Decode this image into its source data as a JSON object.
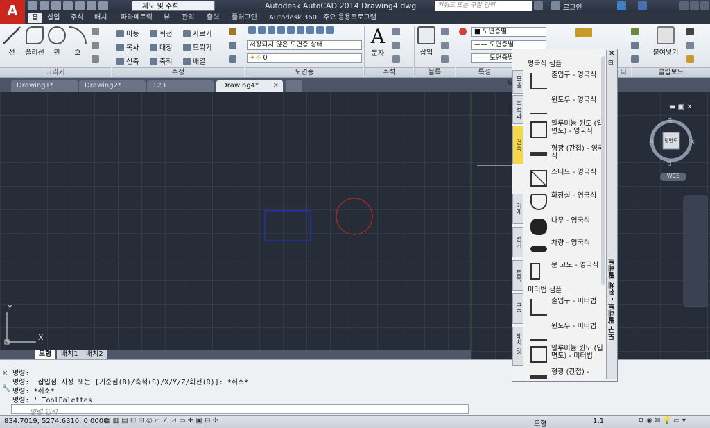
{
  "app": {
    "logo": "A",
    "title": "Autodesk AutoCAD 2014   Drawing4.dwg",
    "workspace": "제도 및 주석",
    "search_placeholder": "키워드 또는 구절 입력",
    "login": "로그인"
  },
  "ribbon_tabs": [
    "홈",
    "삽입",
    "주석",
    "배치",
    "파라메트릭",
    "뷰",
    "관리",
    "출력",
    "플러그인",
    "Autodesk 360",
    "주요 응용프로그램"
  ],
  "draw": {
    "line": "선",
    "polyline": "폴리선",
    "circle": "원",
    "arc": "호",
    "group": "그리기"
  },
  "modify": {
    "move": "이동",
    "rotate": "회전",
    "trim": "자르기",
    "copy": "복사",
    "mirror": "대칭",
    "fillet": "모깎기",
    "stretch": "신축",
    "scale": "축척",
    "array": "배열",
    "group": "수정"
  },
  "layers": {
    "state": "저장되지 않은 도면층 상태",
    "current": "0",
    "group": "도면층"
  },
  "annotation": {
    "text": "문자",
    "group": "주석"
  },
  "block": {
    "insert": "삽입",
    "group": "블록"
  },
  "properties": {
    "color": "도면층별",
    "linetype": "도면층별",
    "lineweight": "도면층별",
    "group": "특성"
  },
  "clipboard": {
    "paste": "붙여넣기",
    "group": "클립보드"
  },
  "utilities": {
    "group": "유틸리티"
  },
  "doc_tabs": [
    "Drawing1*",
    "Drawing2*",
    "123",
    "Drawing4*"
  ],
  "layout_tabs": [
    "모형",
    "배치1",
    "배치2"
  ],
  "viewcube": {
    "top": "북",
    "bottom": "남",
    "left": "서",
    "right": "동",
    "face": "평면도",
    "wcs": "WCS"
  },
  "ucs": {
    "x": "X",
    "y": "Y"
  },
  "command_lines": [
    "명령:",
    "명령:  삽입점 지정 또는 [기준점(B)/축척(S)/X/Y/Z/회전(R)]: *취소*",
    "명령: *취소*",
    "명령: '_ToolPalettes"
  ],
  "command_prompt": "명령 입력",
  "status": {
    "coords": "834.7019,  5274.6310, 0.0000",
    "model": "모형",
    "scale": "1:1"
  },
  "palette": {
    "title": "도구 팔레트 - 전체 팔레트",
    "tabs": [
      "모델링",
      "주석과 설계",
      "건축",
      "기계",
      "전기",
      "토목",
      "구조",
      "해치 및..."
    ],
    "section1": "영국식 샘플",
    "section2": "미터법 샘플",
    "items1": [
      "출입구 - 영국식",
      "윈도우 - 영국식",
      "알루미늄 윈도 (입면도) - 영국식",
      "형광 (간접) - 영국식",
      "스터드 - 영국식",
      "화장실 - 영국식",
      "나무 - 영국식",
      "차량 - 영국식",
      "문 고도 - 영국식"
    ],
    "items2": [
      "출입구 - 미터법",
      "윈도우 - 미터법",
      "알루미늄 윈도 (입면도) - 미터법",
      "형광 (간접) -"
    ]
  },
  "colors": {
    "background": "#262c38",
    "rectangle": "#1e2fd0",
    "circle": "#c0271d",
    "accent": "#c9261d"
  }
}
